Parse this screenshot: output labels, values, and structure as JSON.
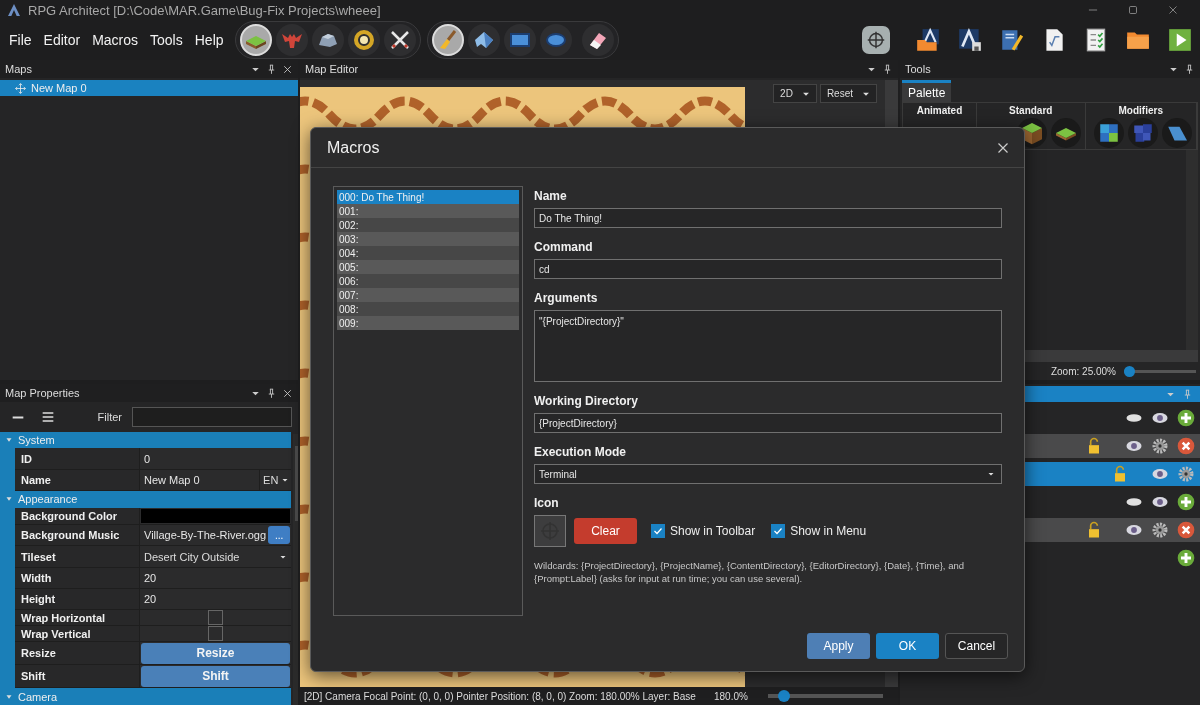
{
  "window": {
    "title": "RPG Architect [D:\\Code\\MAR.Game\\Bug-Fix Projects\\wheee]"
  },
  "menu": [
    "File",
    "Editor",
    "Macros",
    "Tools",
    "Help"
  ],
  "toolbar": {
    "groups": [
      {
        "tools": [
          {
            "kind": "grass",
            "selected": true
          },
          {
            "kind": "demon",
            "selected": false
          },
          {
            "kind": "rock",
            "selected": false
          },
          {
            "kind": "ring",
            "selected": false
          },
          {
            "kind": "swords",
            "selected": false
          }
        ]
      },
      {
        "tools": [
          {
            "kind": "brush",
            "selected": true
          },
          {
            "kind": "shape",
            "selected": false
          },
          {
            "kind": "rectangle",
            "selected": false
          },
          {
            "kind": "ellipse",
            "selected": false
          },
          {
            "kind": "eraser",
            "selected": false
          }
        ]
      }
    ],
    "right_tools": [
      {
        "kind": "crosshair"
      },
      {
        "kind": "folder-chevron"
      },
      {
        "kind": "chevron-save"
      },
      {
        "kind": "notebook"
      },
      {
        "kind": "formula"
      },
      {
        "kind": "checklist"
      },
      {
        "kind": "folder"
      },
      {
        "kind": "play"
      }
    ]
  },
  "maps_panel": {
    "title": "Maps",
    "items": [
      {
        "label": "New Map 0",
        "selected": true
      }
    ]
  },
  "map_properties": {
    "title": "Map Properties",
    "filter_label": "Filter",
    "categories": [
      {
        "label": "System",
        "expanded": true,
        "properties": [
          {
            "kind": "text",
            "label": "ID",
            "value": "0"
          },
          {
            "kind": "localized",
            "label": "Name",
            "value": "New Map 0",
            "language": "EN"
          }
        ]
      },
      {
        "label": "Appearance",
        "expanded": true,
        "properties": [
          {
            "kind": "color",
            "label": "Background Color",
            "color": "#000000"
          },
          {
            "kind": "file",
            "label": "Background Music",
            "value": "Village-By-The-River.ogg",
            "button": "..."
          },
          {
            "kind": "dropdown",
            "label": "Tileset",
            "value": "Desert City Outside"
          },
          {
            "kind": "text",
            "label": "Width",
            "value": "20"
          },
          {
            "kind": "text",
            "label": "Height",
            "value": "20"
          },
          {
            "kind": "checkbox",
            "label": "Wrap Horizontal",
            "checked": false
          },
          {
            "kind": "checkbox",
            "label": "Wrap Vertical",
            "checked": false
          },
          {
            "kind": "button",
            "label": "Resize",
            "button": "Resize"
          },
          {
            "kind": "button",
            "label": "Shift",
            "button": "Shift"
          }
        ]
      },
      {
        "label": "Camera",
        "expanded": true
      }
    ]
  },
  "map_editor": {
    "title": "Map Editor",
    "view_mode": "2D",
    "reset_label": "Reset",
    "status": "[2D] Camera Focal Point: (0, 0, 0) Pointer Position: (8, 0, 0) Zoom: 180.00% Layer: Base",
    "zoom": {
      "reading": "180.0%",
      "level": 0.1
    }
  },
  "tools_panel": {
    "title": "Tools",
    "tabs": [
      {
        "label": "Palette",
        "selected": true
      }
    ],
    "categories": [
      {
        "label": "Animated"
      },
      {
        "label": "Standard",
        "items": [
          {
            "kind": "dirt-block"
          },
          {
            "kind": "grass-tile"
          }
        ]
      },
      {
        "label": "Modifiers",
        "items": [
          {
            "kind": "tiles-grid"
          },
          {
            "kind": "tiles-blue"
          },
          {
            "kind": "slope"
          }
        ]
      }
    ],
    "zoom": {
      "label": "Zoom: 25.00%",
      "level": 0
    }
  },
  "layers_panel": {
    "rows": [
      {
        "kind": "group",
        "selected": false
      },
      {
        "kind": "layer",
        "selected": false
      },
      {
        "kind": "base",
        "selected": true
      },
      {
        "kind": "group",
        "selected": false
      },
      {
        "kind": "layer",
        "selected": false
      },
      {
        "kind": "add",
        "selected": false
      }
    ]
  },
  "macros_dialog": {
    "title": "Macros",
    "macros": [
      {
        "label": "000: Do The Thing!",
        "selected": true
      },
      {
        "label": "001:",
        "selected": false
      },
      {
        "label": "002:",
        "selected": false
      },
      {
        "label": "003:",
        "selected": false
      },
      {
        "label": "004:",
        "selected": false
      },
      {
        "label": "005:",
        "selected": false
      },
      {
        "label": "006:",
        "selected": false
      },
      {
        "label": "007:",
        "selected": false
      },
      {
        "label": "008:",
        "selected": false
      },
      {
        "label": "009:",
        "selected": false
      }
    ],
    "fields": [
      {
        "kind": "text",
        "label": "Name",
        "value": "Do The Thing!"
      },
      {
        "kind": "text",
        "label": "Command",
        "value": "cd"
      },
      {
        "kind": "multiline",
        "label": "Arguments",
        "value": "\"{ProjectDirectory}\""
      },
      {
        "kind": "text",
        "label": "Working Directory",
        "value": "{ProjectDirectory}"
      },
      {
        "kind": "dropdown",
        "label": "Execution Mode",
        "value": "Terminal"
      }
    ],
    "icon": {
      "label": "Icon",
      "clear_label": "Clear",
      "options": [
        {
          "label": "Show in Toolbar",
          "checked": true
        },
        {
          "label": "Show in Menu",
          "checked": true
        }
      ]
    },
    "help": "Wildcards: {ProjectDirectory}, {ProjectName}, {ContentDirectory}, {EditorDirectory}, {Date}, {Time}, and {Prompt:Label} (asks for input at run time; you can use several).",
    "buttons": [
      {
        "kind": "apply",
        "label": "Apply"
      },
      {
        "kind": "primary",
        "label": "OK"
      },
      {
        "kind": "secondary",
        "label": "Cancel"
      }
    ]
  }
}
